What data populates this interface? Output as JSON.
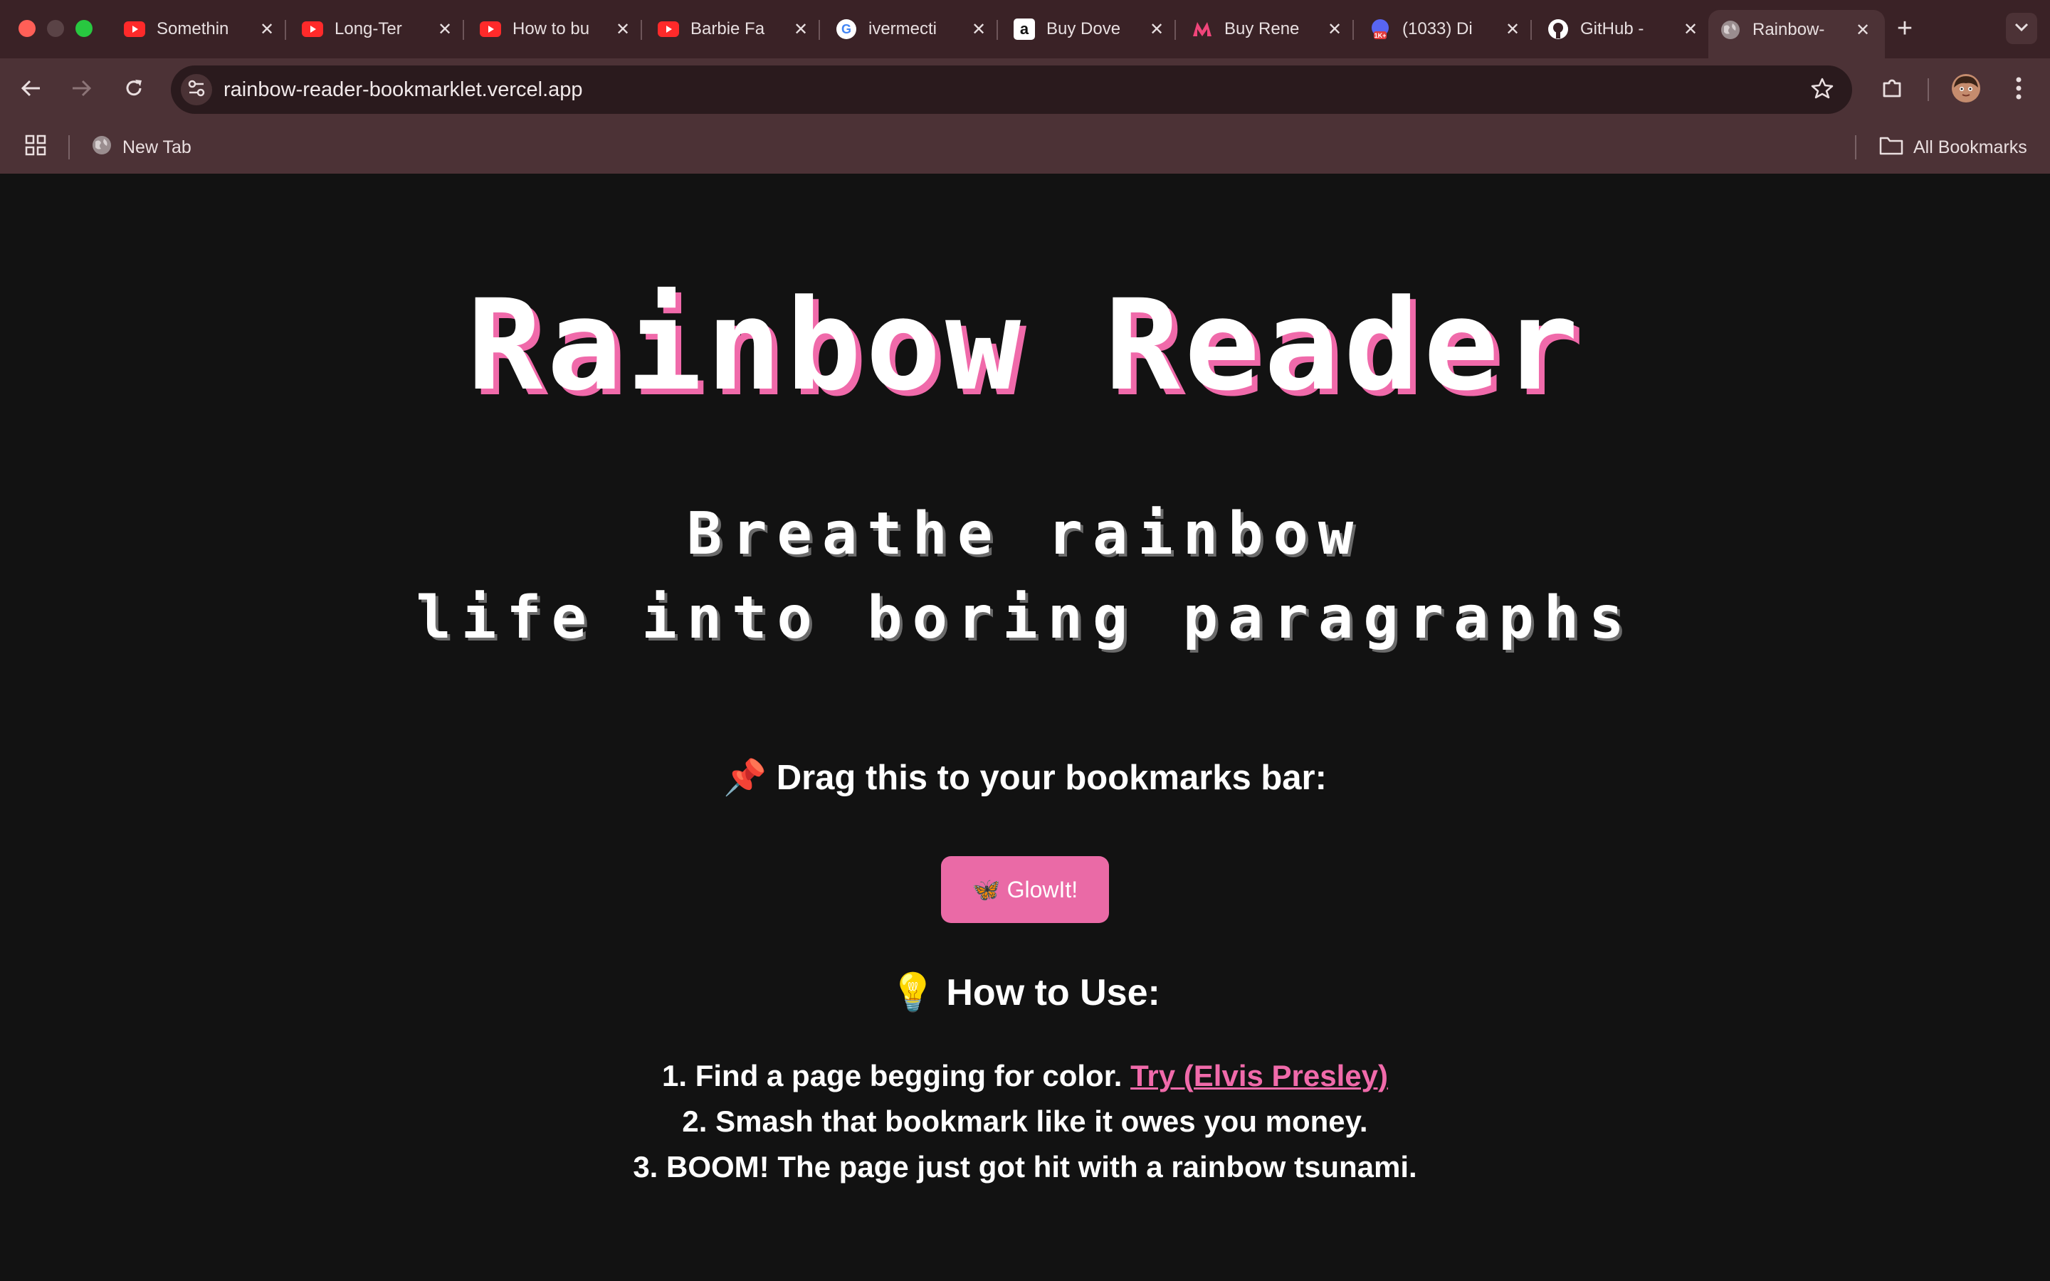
{
  "browser": {
    "tabs": [
      {
        "title": "Somethin",
        "icon": "youtube-icon"
      },
      {
        "title": "Long-Ter",
        "icon": "youtube-icon"
      },
      {
        "title": "How to bu",
        "icon": "youtube-icon"
      },
      {
        "title": "Barbie Fa",
        "icon": "youtube-icon"
      },
      {
        "title": "ivermecti",
        "icon": "google-icon"
      },
      {
        "title": "Buy Dove",
        "icon": "amazon-icon"
      },
      {
        "title": "Buy Rene",
        "icon": "myntra-icon"
      },
      {
        "title": "(1033) Di",
        "icon": "discord-icon"
      },
      {
        "title": "GitHub -",
        "icon": "github-icon"
      },
      {
        "title": "Rainbow-",
        "icon": "globe-icon",
        "active": true
      }
    ],
    "url": "rainbow-reader-bookmarklet.vercel.app",
    "bookmarks": {
      "new_tab_label": "New Tab",
      "all_bookmarks_label": "All Bookmarks"
    },
    "colors": {
      "tabstrip": "#3a2226",
      "toolbar": "#4c3236"
    }
  },
  "page": {
    "title": "Rainbow Reader",
    "subtitle_line1": "Breathe rainbow",
    "subtitle_line2": "life into boring paragraphs",
    "drag_icon": "📌",
    "drag_text": "Drag this to your bookmarks bar:",
    "glow_button_label": "🦋 GlowIt!",
    "howto_icon": "💡",
    "howto_text": "How to Use:",
    "steps": {
      "step1_text": "1. Find a page begging for color.",
      "step1_link": "Try (Elvis Presley)",
      "step2_text": "2. Smash that bookmark like it owes you money.",
      "step3_text": "3. BOOM! The page just got hit with a rainbow tsunami."
    },
    "colors": {
      "background": "#121212",
      "accent_pink": "#ea6aa6",
      "text": "#ffffff"
    }
  }
}
